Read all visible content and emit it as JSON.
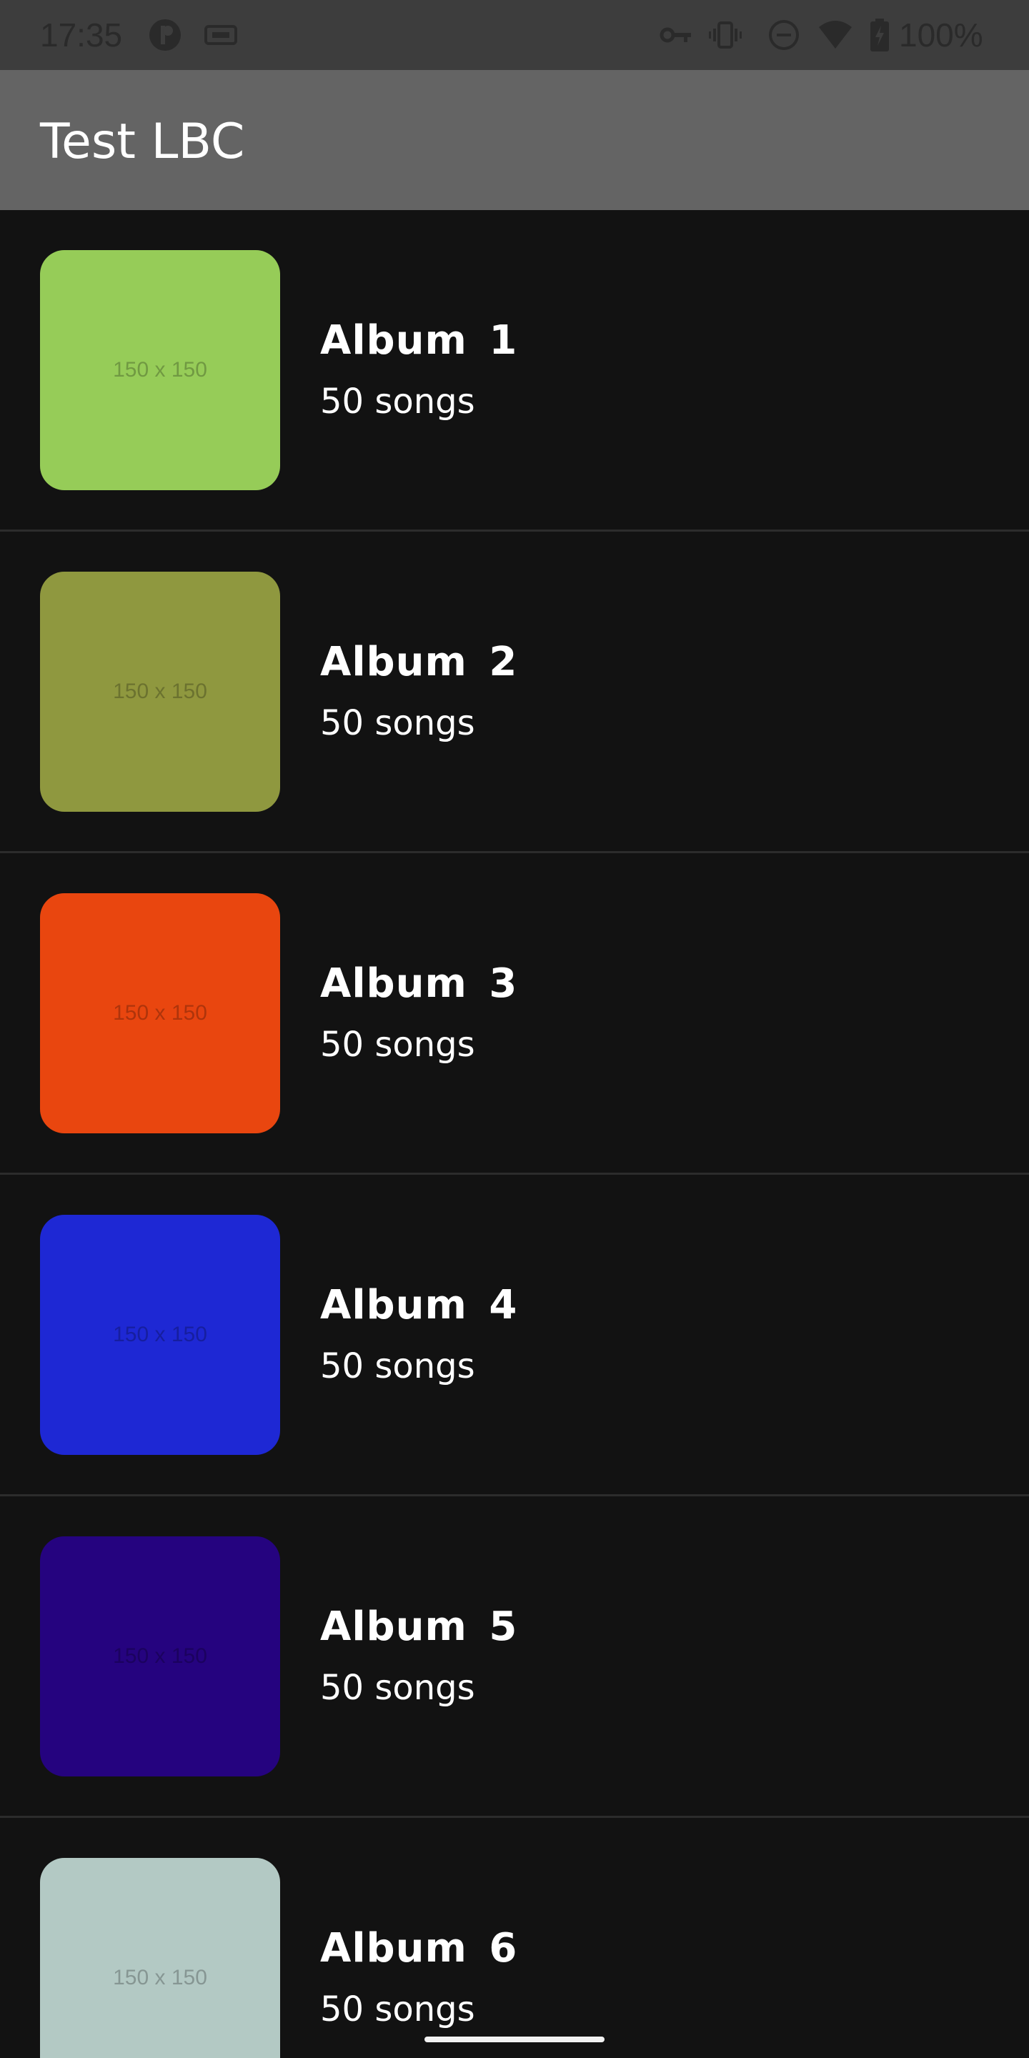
{
  "status_bar": {
    "time": "17:35",
    "battery": "100%",
    "icons": [
      "app-notification-icon",
      "cast-icon",
      "vpn-key-icon",
      "vibrate-icon",
      "do-not-disturb-icon",
      "wifi-icon",
      "battery-charging-icon"
    ]
  },
  "app_bar": {
    "title": "Test LBC"
  },
  "albums": [
    {
      "name": "Album 1",
      "songs": "50 songs",
      "art_label": "150 x 150",
      "color": "#96cc58"
    },
    {
      "name": "Album 2",
      "songs": "50 songs",
      "art_label": "150 x 150",
      "color": "#8f983f"
    },
    {
      "name": "Album 3",
      "songs": "50 songs",
      "art_label": "150 x 150",
      "color": "#e9460f"
    },
    {
      "name": "Album 4",
      "songs": "50 songs",
      "art_label": "150 x 150",
      "color": "#1e28d4"
    },
    {
      "name": "Album 5",
      "songs": "50 songs",
      "art_label": "150 x 150",
      "color": "#25037f"
    },
    {
      "name": "Album 6",
      "songs": "50 songs",
      "art_label": "150 x 150",
      "color": "#b3c9c4"
    }
  ],
  "colors": {
    "background": "#121212",
    "status_bar": "#3d3d3d",
    "app_bar": "#646464",
    "divider": "#2c2c2c"
  }
}
